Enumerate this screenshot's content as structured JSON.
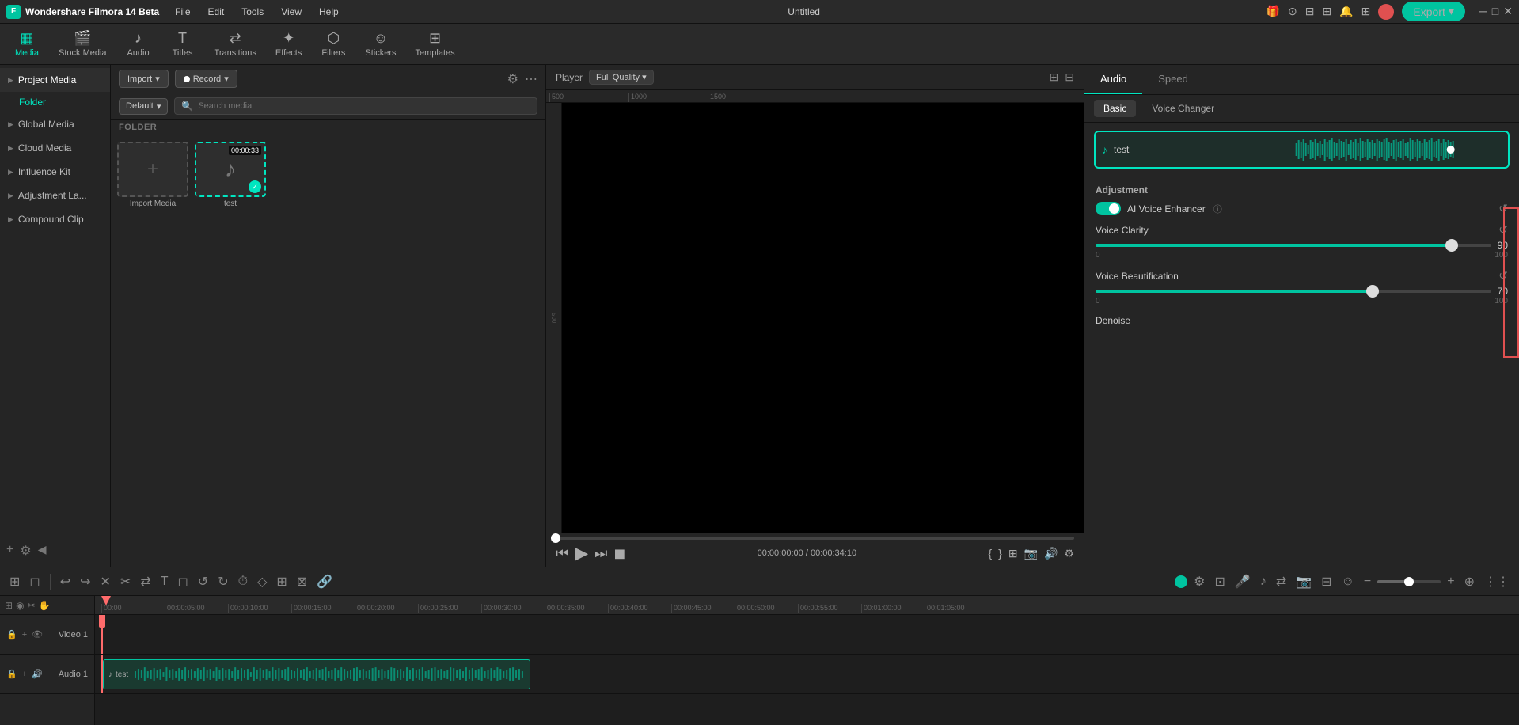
{
  "app": {
    "title": "Wondershare Filmora 14 Beta",
    "window_title": "Untitled",
    "logo_letter": "F"
  },
  "menu": {
    "items": [
      "File",
      "Edit",
      "Tools",
      "View",
      "Help"
    ]
  },
  "toolbar": {
    "items": [
      {
        "id": "media",
        "label": "Media",
        "icon": "▦",
        "active": true
      },
      {
        "id": "stock-media",
        "label": "Stock Media",
        "icon": "🎬"
      },
      {
        "id": "audio",
        "label": "Audio",
        "icon": "♪"
      },
      {
        "id": "titles",
        "label": "Titles",
        "icon": "T"
      },
      {
        "id": "transitions",
        "label": "Transitions",
        "icon": "⇄"
      },
      {
        "id": "effects",
        "label": "Effects",
        "icon": "✦"
      },
      {
        "id": "filters",
        "label": "Filters",
        "icon": "⬡"
      },
      {
        "id": "stickers",
        "label": "Stickers",
        "icon": "☺"
      },
      {
        "id": "templates",
        "label": "Templates",
        "icon": "⊞"
      }
    ],
    "export_label": "Export"
  },
  "left_panel": {
    "items": [
      {
        "id": "project-media",
        "label": "Project Media",
        "active": true
      },
      {
        "id": "folder",
        "label": "Folder",
        "is_folder": true
      },
      {
        "id": "global-media",
        "label": "Global Media"
      },
      {
        "id": "cloud-media",
        "label": "Cloud Media"
      },
      {
        "id": "influence-kit",
        "label": "Influence Kit"
      },
      {
        "id": "adjustment-la",
        "label": "Adjustment La..."
      },
      {
        "id": "compound-clip",
        "label": "Compound Clip"
      }
    ]
  },
  "media_panel": {
    "import_label": "Import",
    "record_label": "Record",
    "default_label": "Default",
    "search_placeholder": "Search media",
    "folder_label": "FOLDER",
    "import_media_label": "Import Media",
    "media_items": [
      {
        "id": "test",
        "name": "test",
        "duration": "00:00:33",
        "selected": true,
        "type": "audio"
      }
    ]
  },
  "preview": {
    "player_label": "Player",
    "quality_label": "Full Quality",
    "current_time": "00:00:00:00",
    "total_time": "00:00:34:10"
  },
  "right_panel": {
    "tabs": [
      {
        "id": "audio",
        "label": "Audio",
        "active": true
      },
      {
        "id": "speed",
        "label": "Speed"
      }
    ],
    "sub_tabs": [
      {
        "id": "basic",
        "label": "Basic",
        "active": true
      },
      {
        "id": "voice-changer",
        "label": "Voice Changer"
      }
    ],
    "track_name": "test",
    "adjustment": {
      "title": "Adjustment",
      "ai_voice_enhancer": "AI Voice Enhancer",
      "ai_voice_enabled": true,
      "voice_clarity": {
        "label": "Voice Clarity",
        "value": 90,
        "min": 0,
        "max": 100,
        "fill_pct": 90
      },
      "voice_beautification": {
        "label": "Voice Beautification",
        "value": 70,
        "min": 0,
        "max": 100,
        "fill_pct": 70
      },
      "denoise": {
        "label": "Denoise"
      }
    }
  },
  "timeline": {
    "toolbar_icons": [
      "⊞",
      "◻",
      "|",
      "↩",
      "↪",
      "✕",
      "✂",
      "⇄",
      "T",
      "◻",
      "↺",
      "↻",
      "⏱",
      "◇",
      "⊞",
      "⊠",
      "⊙",
      "🔗"
    ],
    "ruler_marks": [
      "00:00",
      "00:00:05:00",
      "00:00:10:00",
      "00:00:15:00",
      "00:00:20:00",
      "00:00:25:00",
      "00:00:30:00",
      "00:00:35:00",
      "00:00:40:00",
      "00:00:45:00",
      "00:00:50:00",
      "00:00:55:00",
      "00:01:00:00",
      "00:01:05:00"
    ],
    "tracks": [
      {
        "id": "video1",
        "name": "Video 1",
        "type": "video"
      },
      {
        "id": "audio1",
        "name": "Audio 1",
        "type": "audio",
        "has_clip": true,
        "clip_name": "test"
      }
    ]
  }
}
